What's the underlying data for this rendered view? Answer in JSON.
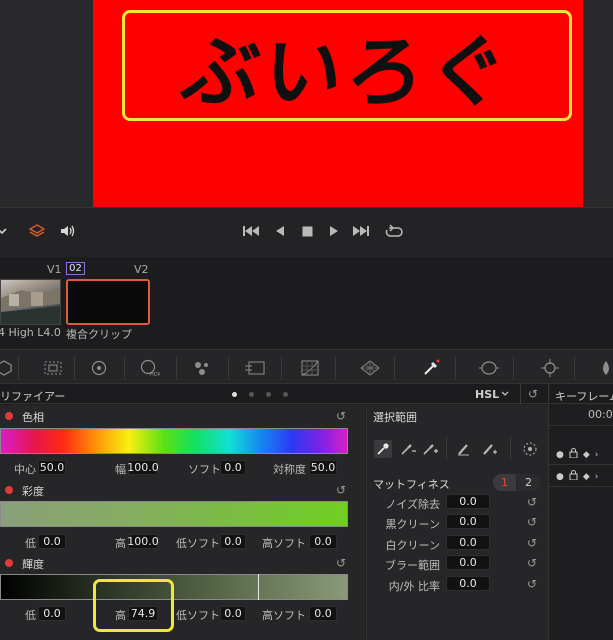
{
  "viewer": {
    "overlay_text": "ぶいろぐ"
  },
  "clips": {
    "track_v1": "V1",
    "track_v2": "V2",
    "badge": "02",
    "clip1_name": "4 High L4.0",
    "clip2_name": "複合クリップ"
  },
  "panel": {
    "title": "リファイアー",
    "mode": "HSL",
    "keyframe_title": "キーフレーム",
    "timecode": "00:0"
  },
  "hue": {
    "label": "色相",
    "center_label": "中心",
    "center": "50.0",
    "width_label": "幅",
    "width": "100.0",
    "soft_label": "ソフト",
    "soft": "0.0",
    "sym_label": "対称度",
    "sym": "50.0"
  },
  "sat": {
    "label": "彩度",
    "low_label": "低",
    "low": "0.0",
    "high_label": "高",
    "high": "100.0",
    "low_soft_label": "低ソフト",
    "low_soft": "0.0",
    "high_soft_label": "高ソフト",
    "high_soft": "0.0"
  },
  "lum": {
    "label": "輝度",
    "low_label": "低",
    "low": "0.0",
    "high_label": "高",
    "high": "74.9",
    "low_soft_label": "低ソフト",
    "low_soft": "0.0",
    "high_soft_label": "高ソフト",
    "high_soft": "0.0"
  },
  "selection": {
    "title": "選択範囲",
    "matte_title": "マットフィネス",
    "seg1": "1",
    "seg2": "2",
    "rows": [
      {
        "label": "ノイズ除去",
        "value": "0.0"
      },
      {
        "label": "黒クリーン",
        "value": "0.0"
      },
      {
        "label": "白クリーン",
        "value": "0.0"
      },
      {
        "label": "ブラー範囲",
        "value": "0.0"
      },
      {
        "label": "内/外 比率",
        "value": "0.0"
      }
    ]
  },
  "colors": {
    "accent_red": "#e03a3a",
    "highlight_yellow": "#f2e63a",
    "clip_border": "#e05a3e"
  }
}
